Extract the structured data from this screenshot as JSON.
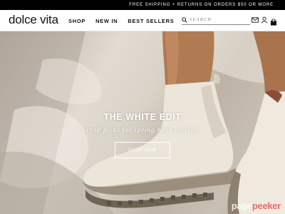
{
  "promo": {
    "text": "FREE SHIPPING + RETURNS ON ORDERS $50 OR MORE"
  },
  "header": {
    "logo": "dolce vita",
    "nav": [
      {
        "label": "SHOP"
      },
      {
        "label": "NEW IN"
      },
      {
        "label": "BEST SELLERS"
      }
    ],
    "search": {
      "placeholder": "SEARCH",
      "value": ""
    },
    "icons": [
      "search-icon",
      "mail-icon",
      "account-icon",
      "bag-icon"
    ],
    "bag_count": "0"
  },
  "hero": {
    "title": "THE WHITE EDIT",
    "subtitle": "crop picks for spring have arrived",
    "cta_label": "SHOP NOW"
  },
  "watermark": {
    "part1": "page",
    "part2": "peeker"
  },
  "colors": {
    "promo_bg": "#000000",
    "text_dark": "#111111",
    "hero_text": "#ffffff",
    "boot_color": "#ece6da"
  }
}
